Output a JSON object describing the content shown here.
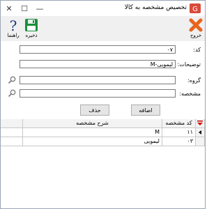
{
  "window": {
    "title": "تخصیص مشخصه به کالا"
  },
  "toolbar": {
    "exit_label": "خروج",
    "save_label": "ذخیره",
    "help_label": "راهنما"
  },
  "form": {
    "code_label": "کد:",
    "code_value": "۰۷",
    "description_label": "توضیحات:",
    "description_value": "لیمویی-M",
    "group_label": "گروه:",
    "group_value": "",
    "attribute_label": "مشخصه:",
    "attribute_value": ""
  },
  "buttons": {
    "add_label": "اضافه",
    "delete_label": "حذف"
  },
  "grid": {
    "columns": {
      "code": "کد مشخصه",
      "description": "شرح مشخصه"
    },
    "rows": [
      {
        "code": "۱۱",
        "description": "M"
      },
      {
        "code": "۰۳",
        "description": "لیمویی"
      }
    ]
  },
  "colors": {
    "close_orange": "#e8641e",
    "save_green": "#1a8f3c",
    "filter_red": "#cc0000"
  }
}
